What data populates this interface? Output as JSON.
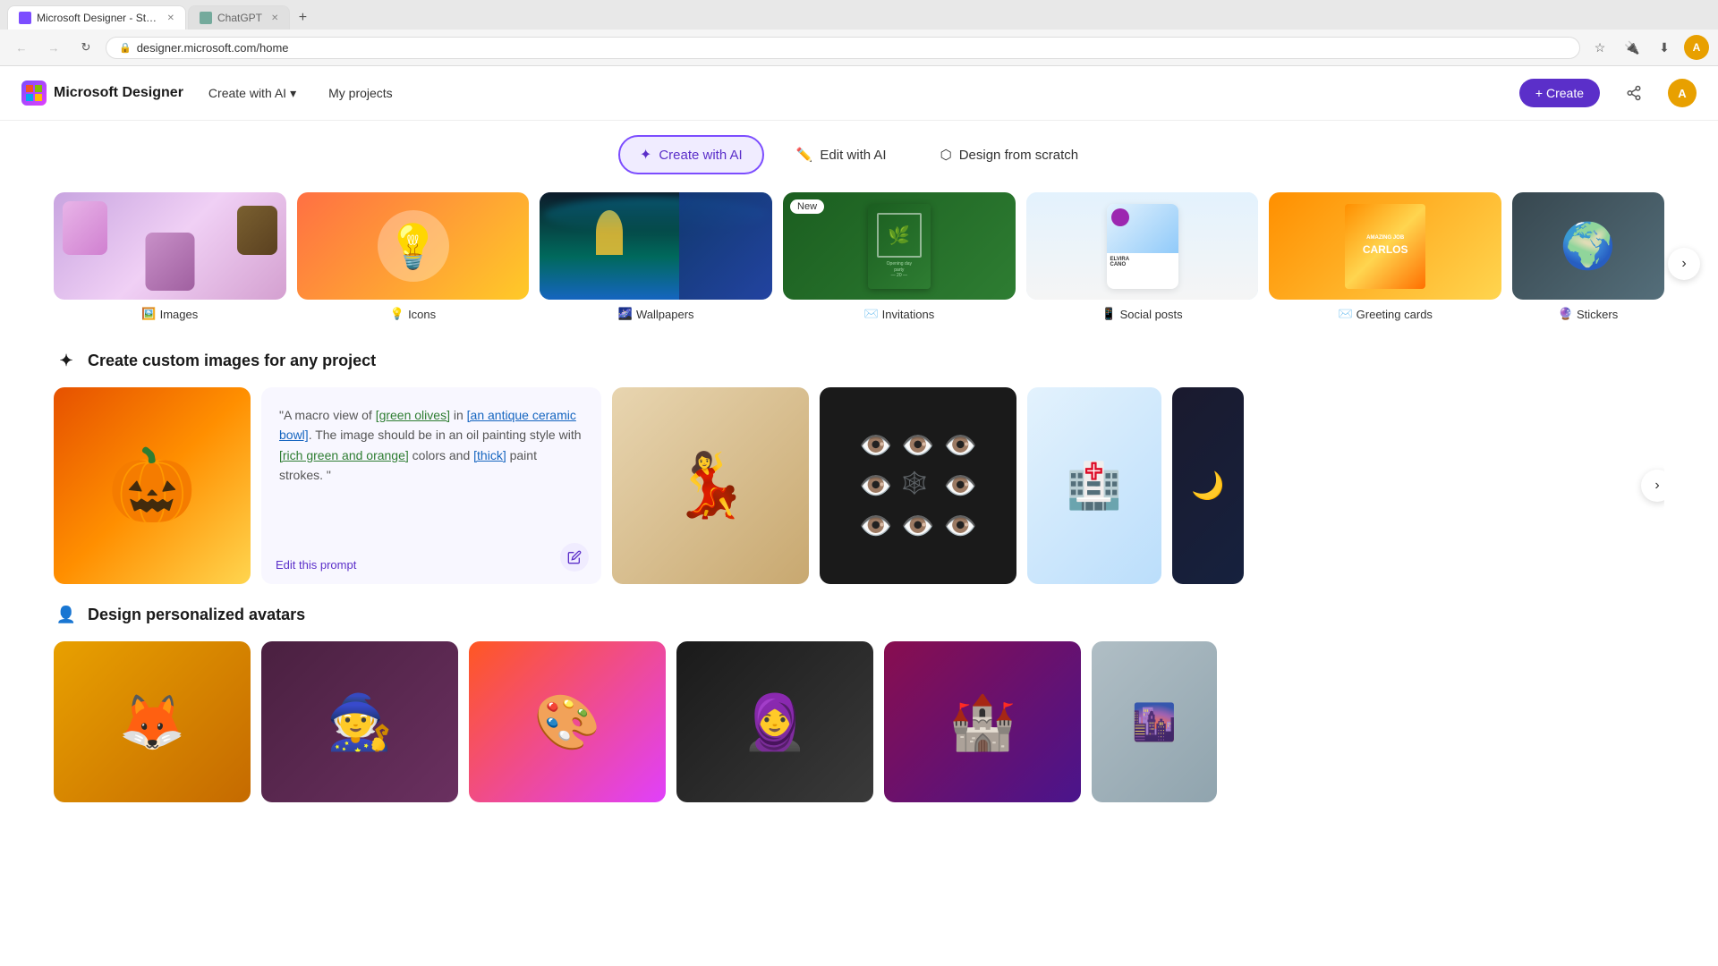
{
  "browser": {
    "tabs": [
      {
        "id": "tab1",
        "title": "Microsoft Designer - Stunning",
        "favicon_type": "msdesigner",
        "active": true
      },
      {
        "id": "tab2",
        "title": "ChatGPT",
        "favicon_type": "chatgpt",
        "active": false
      }
    ],
    "new_tab_symbol": "+",
    "address": "designer.microsoft.com/home",
    "nav_back": "←",
    "nav_forward": "→",
    "nav_reload": "↻"
  },
  "app": {
    "brand": {
      "logo_text": "M",
      "name": "Microsoft Designer"
    },
    "nav": {
      "create_with_ai_label": "Create with AI",
      "dropdown_icon": "▾",
      "my_projects_label": "My projects",
      "create_btn_label": "+ Create"
    },
    "actions_bar": {
      "create_ai": {
        "icon": "✦",
        "label": "Create with AI",
        "active": true
      },
      "edit_ai": {
        "icon": "✏",
        "label": "Edit with AI",
        "active": false
      },
      "design_scratch": {
        "icon": "◈",
        "label": "Design from scratch",
        "active": false
      }
    },
    "categories": [
      {
        "id": "images",
        "label": "Images",
        "icon": "🖼",
        "bg": "cat-images"
      },
      {
        "id": "icons",
        "label": "Icons",
        "icon": "💡",
        "bg": "cat-icons"
      },
      {
        "id": "wallpapers",
        "label": "Wallpapers",
        "icon": "🌌",
        "bg": "cat-wallpapers"
      },
      {
        "id": "invitations",
        "label": "Invitations",
        "icon": "✉",
        "bg": "cat-invitations",
        "new": true
      },
      {
        "id": "social-posts",
        "label": "Social posts",
        "icon": "📱",
        "bg": "cat-social"
      },
      {
        "id": "greeting-cards",
        "label": "Greeting cards",
        "icon": "✉",
        "bg": "cat-greeting"
      },
      {
        "id": "stickers",
        "label": "Stickers",
        "icon": "🔮",
        "bg": "cat-stickers"
      }
    ],
    "new_badge_text": "New",
    "custom_images_section": {
      "title": "Create custom images for any project",
      "icon": "✦",
      "prompt_text": "\"A macro view of ",
      "prompt_highlight1": "[green olives]",
      "prompt_mid1": " in ",
      "prompt_highlight2": "[an antique ceramic bowl]",
      "prompt_mid2": ". The image should be in an oil painting style with ",
      "prompt_highlight3": "[rich green and orange]",
      "prompt_mid3": " colors and ",
      "prompt_highlight4": "[thick]",
      "prompt_end": " paint strokes. \"",
      "edit_prompt_label": "Edit this prompt"
    },
    "avatars_section": {
      "title": "Design personalized avatars",
      "icon": "👤"
    }
  }
}
